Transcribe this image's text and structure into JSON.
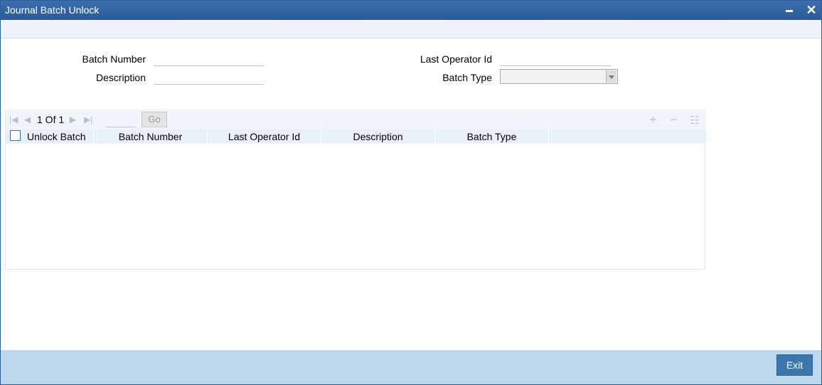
{
  "window": {
    "title": "Journal Batch Unlock"
  },
  "form": {
    "batch_number_label": "Batch Number",
    "batch_number_value": "",
    "description_label": "Description",
    "description_value": "",
    "last_operator_label": "Last Operator Id",
    "last_operator_value": "",
    "batch_type_label": "Batch Type",
    "batch_type_value": ""
  },
  "grid": {
    "page_info": "1 Of 1",
    "page_input": "",
    "go_label": "Go",
    "columns": [
      "Unlock Batch",
      "Batch Number",
      "Last Operator Id",
      "Description",
      "Batch Type"
    ],
    "rows": []
  },
  "footer": {
    "exit_label": "Exit"
  },
  "colors": {
    "titlebar": "#2f62a0",
    "footer": "#bcd8ec",
    "exit_button": "#3c76aa"
  }
}
